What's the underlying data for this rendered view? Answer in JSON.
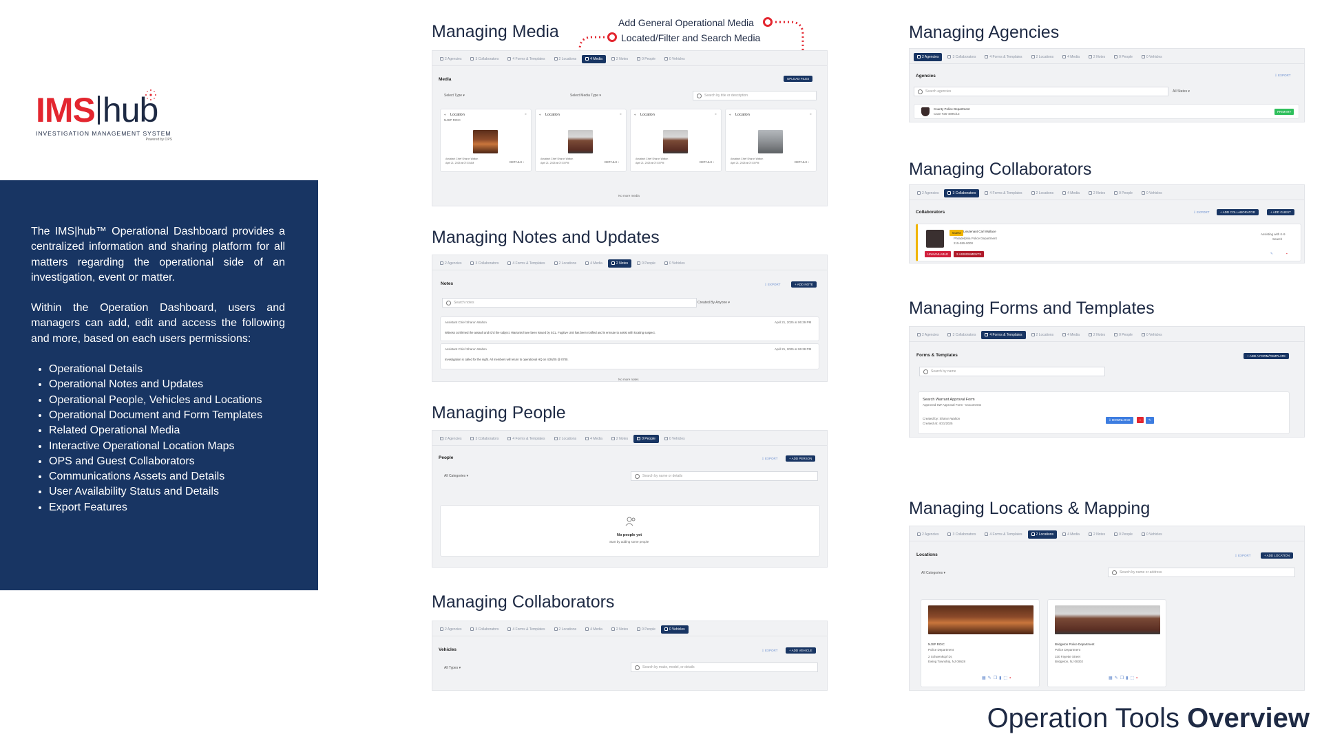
{
  "brand": {
    "logo_ims": "IMS",
    "logo_hub": "hub",
    "logo_sub": "INVESTIGATION MANAGEMENT SYSTEM",
    "logo_powered": "Powered by OPS"
  },
  "panel": {
    "para1": "The IMS|hub™ Operational Dashboard provides a centralized information and sharing platform for all matters regarding the operational side of an investigation, event or matter.",
    "para2": "Within the Operation Dashboard, users and managers can add, edit and access the following and more, based on each users permissions:",
    "features": [
      "Operational Details",
      "Operational Notes and Updates",
      "Operational People, Vehicles and Locations",
      "Operational Document and Form Templates",
      "Related Operational Media",
      "Interactive Operational Location Maps",
      "OPS and Guest Collaborators",
      "Communications Assets and Details",
      "User Availability Status and Details",
      "Export Features"
    ]
  },
  "footer": {
    "light": "Operation Tools ",
    "bold": "Overview"
  },
  "tabs_generic": [
    "2 Agencies",
    "3 Collaborators",
    "4 Forms & Templates",
    "2 Locations",
    "4 Media",
    "2 Notes",
    "0 People",
    "0 Vehicles"
  ],
  "media": {
    "heading": "Managing Media",
    "callout_add": "Add General Operational Media",
    "callout_filter": "Located/Filter and Search Media",
    "tabs": [
      "2 Agencies",
      "3 Collaborators",
      "4 Forms & Templates",
      "2 Locations",
      "4 Media",
      "2 Notes",
      "0 People",
      "0 Vehicles"
    ],
    "title": "Media",
    "upload": "UPLOAD FILES",
    "select_type": "Select Type ▾",
    "select_media_type": "Select Media Type ▾",
    "search_placeholder": "Search by title or description",
    "cards": [
      {
        "label": "Location",
        "sub": "NJSP ROIC",
        "by": "Assistant Chief Sharon Walton",
        "date": "April 21, 2025 at 07:03 AM",
        "details": "DETAILS ›"
      },
      {
        "label": "Location",
        "sub": "",
        "by": "Assistant Chief Sharon Walton",
        "date": "April 21, 2025 at 07:03 PM",
        "details": "DETAILS ›"
      },
      {
        "label": "Location",
        "sub": "",
        "by": "Assistant Chief Sharon Walton",
        "date": "April 21, 2025 at 07:03 PM",
        "details": "DETAILS ›"
      },
      {
        "label": "Location",
        "sub": "",
        "by": "Assistant Chief Sharon Walton",
        "date": "April 21, 2025 at 07:03 PM",
        "details": "DETAILS ›"
      }
    ],
    "no_more": "No more media"
  },
  "notes": {
    "heading": "Managing Notes and Updates",
    "title": "Notes",
    "export": "⇩ EXPORT",
    "add": "+ ADD NOTE",
    "search_placeholder": "Search notes",
    "created_by": "Created By Anyone ▾",
    "items": [
      {
        "by": "Assistant Chief Sharon Walton",
        "date": "April 21, 2025 at 06:39 PM",
        "body": "Witness confirmed the assault and ID'd the subject. Warrants have been issued by SCL. Fugitive Unit has been notified and is enroute to assist with locating suspect."
      },
      {
        "by": "Assistant Chief Sharon Walton",
        "date": "April 21, 2025 at 06:38 PM",
        "body": "Investigation is called for the night. All members will return to operational HQ on 4/26/25 @ 0700."
      }
    ],
    "no_more": "No more notes"
  },
  "people": {
    "heading": "Managing People",
    "title": "People",
    "export": "⇩ EXPORT",
    "add": "+ ADD PERSON",
    "categories": "All Categories ▾",
    "search_placeholder": "Search by name or details",
    "empty_title": "No people yet",
    "empty_sub": "Start by adding some people"
  },
  "vehicles": {
    "heading": "Managing Collaborators",
    "title": "Vehicles",
    "export": "⇩ EXPORT",
    "add": "+ ADD VEHICLE",
    "types": "All Types ▾",
    "search_placeholder": "Search by make, model, or details"
  },
  "agencies": {
    "heading": "Managing Agencies",
    "title": "Agencies",
    "export": "⇩ EXPORT",
    "search_placeholder": "Search agencies",
    "states": "All States ▾",
    "item_name": "County Police Department",
    "item_sub": "Case #25-489K/13",
    "primary": "PRIMARY"
  },
  "collaborators": {
    "heading": "Managing Collaborators",
    "title": "Collaborators",
    "export": "⇩ EXPORT",
    "add_collab": "+ ADD COLLABORATOR",
    "add_guest": "+ ADD GUEST",
    "badge": "Guest",
    "name": "Lieutenant Carl Wallace",
    "agency": "Philadelphia Police Department",
    "phone": "215-555-0000",
    "status": "UNAVAILABLE",
    "assignments": "2 ASSIGNMENTS",
    "assisting": "Assisting with K-9",
    "role": "Search"
  },
  "forms": {
    "heading": "Managing Forms and Templates",
    "title": "Forms & Templates",
    "add": "+ ADD A FORM/TEMPLATE",
    "search_placeholder": "Search by name",
    "item_name": "Search Warrant Approval Form",
    "item_sub": "Approved SW Approval Form - Documents",
    "created_by": "Created by: Sharon Walton",
    "created_at": "Created at: 4/21/2025",
    "download": "⇩ DOWNLOAD"
  },
  "locations": {
    "heading": "Managing Locations & Mapping",
    "title": "Locations",
    "export": "⇩ EXPORT",
    "add": "+ ADD LOCATION",
    "categories": "All Categories ▾",
    "search_placeholder": "Search by name or address",
    "cards": [
      {
        "name": "NJSP ROIC",
        "type": "Police Department",
        "addr1": "2 Schwenkopf Dr,",
        "addr2": "Ewing Township, NJ 08628"
      },
      {
        "name": "Bridgeton Police Department",
        "type": "Police Department",
        "addr1": "330 Fayette Street",
        "addr2": "Bridgeton, NJ 08302"
      }
    ]
  },
  "colors": {
    "navy": "#183563",
    "red": "#e3262f",
    "green": "#2fbf5c"
  }
}
